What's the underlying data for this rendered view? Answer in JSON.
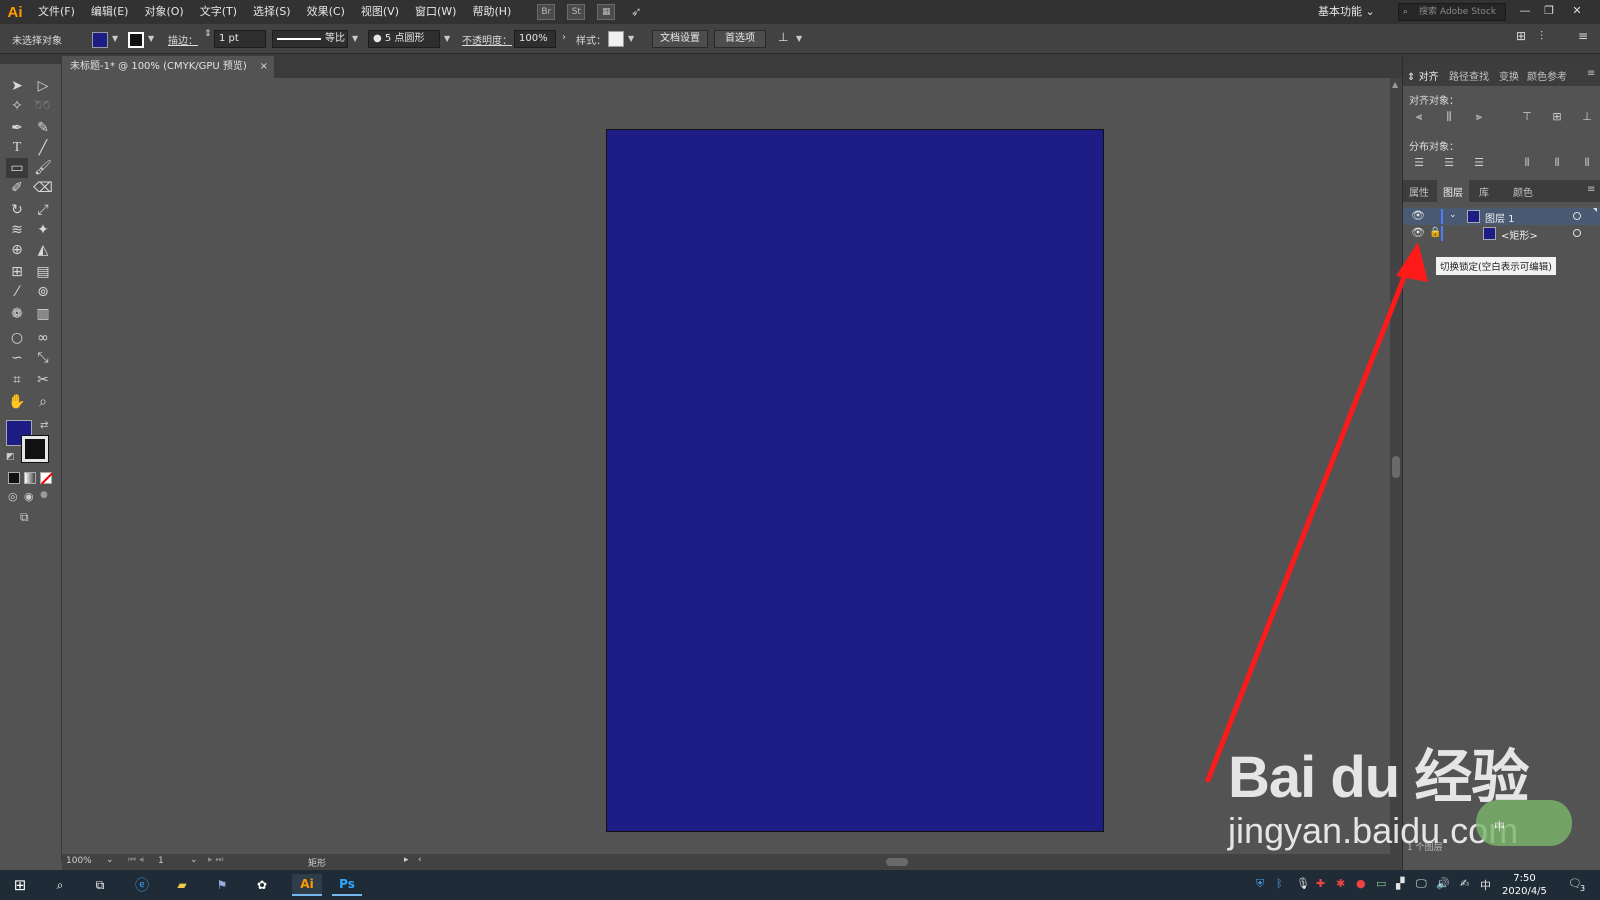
{
  "app": {
    "logo": "Ai"
  },
  "menu": [
    "文件(F)",
    "编辑(E)",
    "对象(O)",
    "文字(T)",
    "选择(S)",
    "效果(C)",
    "视图(V)",
    "窗口(W)",
    "帮助(H)"
  ],
  "menu_icons": [
    "Br",
    "St"
  ],
  "workspace": "基本功能",
  "stock_search_placeholder": "搜索 Adobe Stock",
  "control_bar": {
    "selection_label": "未选择对象",
    "stroke_label": "描边：",
    "stroke_weight": "1 pt",
    "stroke_profile": "等比",
    "brush": "5 点圆形",
    "opacity_label": "不透明度：",
    "opacity": "100%",
    "style_label": "样式：",
    "doc_setup": "文档设置",
    "preferences": "首选项"
  },
  "document_tab": {
    "title": "未标题-1* @ 100% (CMYK/GPU 预览)",
    "close": "×"
  },
  "status_bar": {
    "zoom": "100%",
    "page": "1",
    "tool": "矩形"
  },
  "align_panel": {
    "tabs": [
      "对齐",
      "路径查找",
      "变换",
      "颜色参考"
    ],
    "align_objects": "对齐对象：",
    "distribute_objects": "分布对象："
  },
  "layers_panel": {
    "tabs": [
      "属性",
      "图层",
      "库",
      "颜色"
    ],
    "active_tab": "图层",
    "layers": [
      {
        "name": "图层 1"
      },
      {
        "name": "<矩形>"
      }
    ],
    "tooltip": "切换锁定(空白表示可编辑)",
    "footer": "1 个图层"
  },
  "taskbar": {
    "clock_time": "7:50",
    "clock_date": "2020/4/5",
    "ime": "中",
    "notification_count": "3",
    "apps": [
      "Ai",
      "Ps"
    ]
  },
  "watermark": {
    "brand": "Bai du 经验",
    "url": "jingyan.baidu.com"
  },
  "colors": {
    "artboard": "#1d1d85",
    "annotation_arrow": "#ff1a1a",
    "ai_logo": "#ff9a00"
  }
}
